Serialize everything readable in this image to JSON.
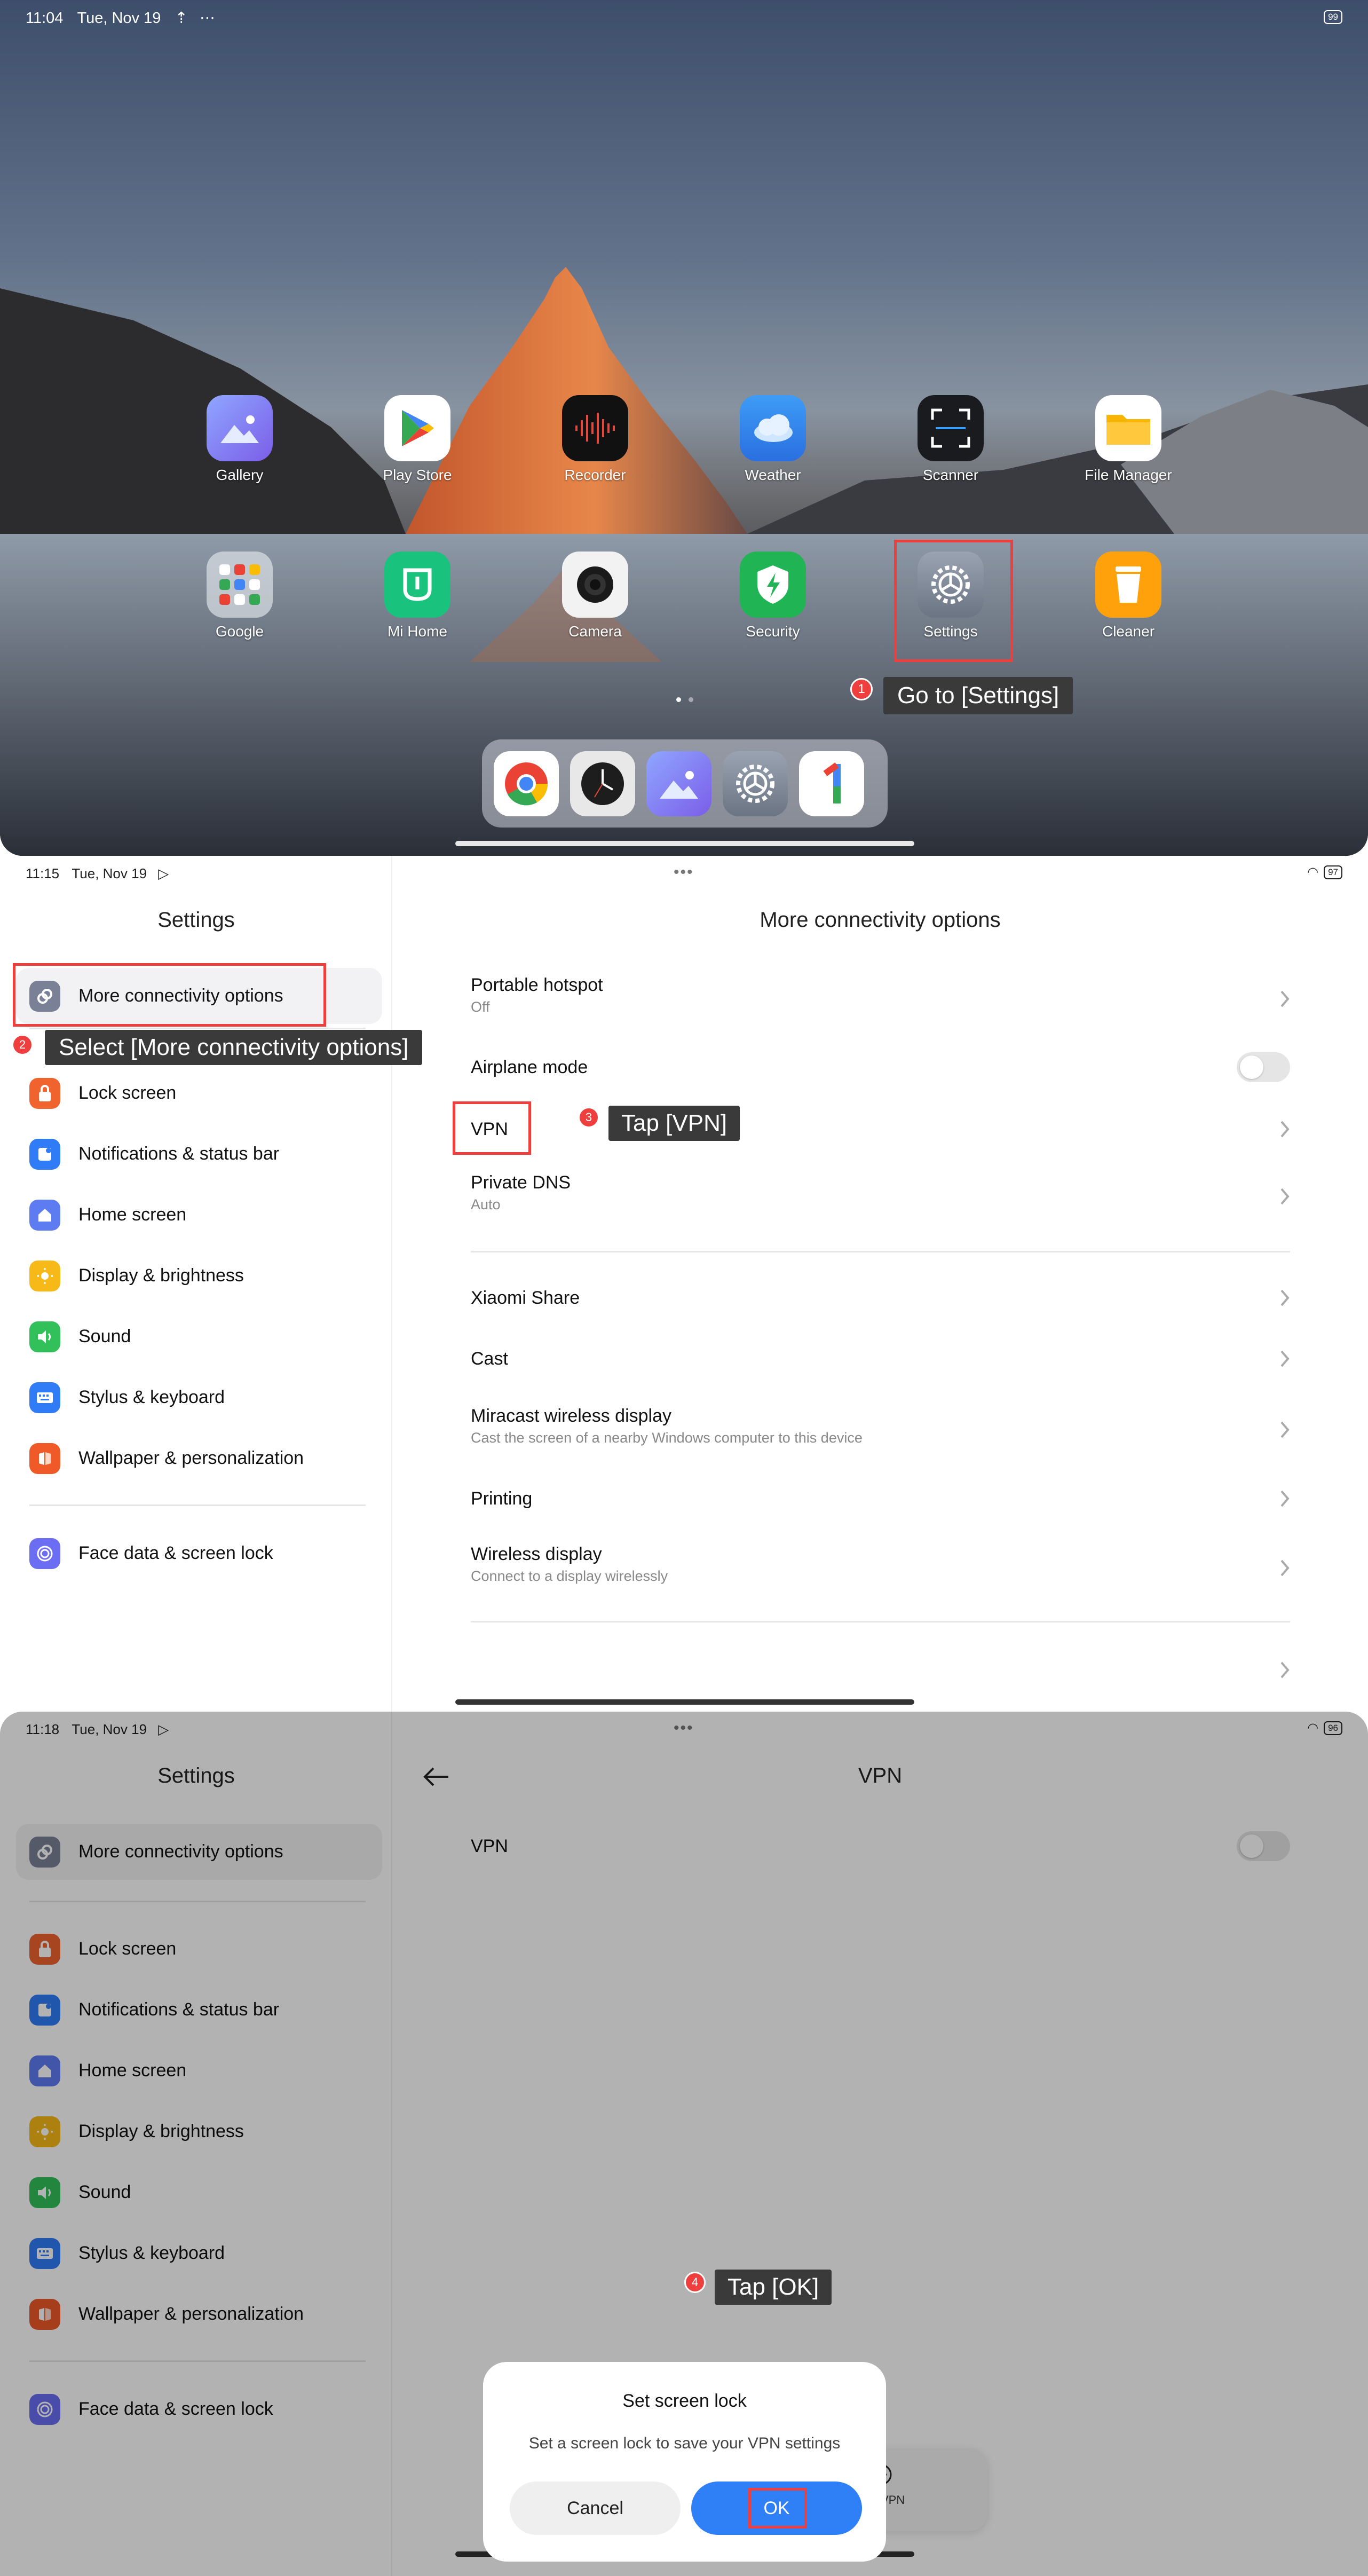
{
  "home": {
    "status": {
      "time": "11:04",
      "date": "Tue, Nov 19",
      "extra": "⋯",
      "battery": "99"
    },
    "apps_row1": [
      {
        "label": "Gallery",
        "icon": "gallery-icon"
      },
      {
        "label": "Play Store",
        "icon": "play-store-icon"
      },
      {
        "label": "Recorder",
        "icon": "recorder-icon"
      },
      {
        "label": "Weather",
        "icon": "weather-icon"
      },
      {
        "label": "Scanner",
        "icon": "scanner-icon"
      },
      {
        "label": "File Manager",
        "icon": "folder-icon"
      }
    ],
    "apps_row2": [
      {
        "label": "Google",
        "icon": "google-folder-icon"
      },
      {
        "label": "Mi Home",
        "icon": "mi-home-icon"
      },
      {
        "label": "Camera",
        "icon": "camera-icon"
      },
      {
        "label": "Security",
        "icon": "security-icon"
      },
      {
        "label": "Settings",
        "icon": "settings-gear-icon"
      },
      {
        "label": "Cleaner",
        "icon": "cleaner-icon"
      }
    ],
    "dock": [
      "chrome-icon",
      "clock-icon",
      "gallery-icon",
      "settings-gear-icon",
      "google-one-icon"
    ],
    "step": {
      "number": "1",
      "text": "Go to [Settings]"
    }
  },
  "settings_panel": {
    "status": {
      "time": "11:15",
      "date": "Tue, Nov 19",
      "battery": "97"
    },
    "title": "Settings",
    "menu": [
      {
        "label": "More connectivity options",
        "icon": "link-icon",
        "color": "#7a8197"
      },
      {
        "label": "Lock screen",
        "icon": "lock-icon",
        "color": "#f0632e"
      },
      {
        "label": "Notifications & status bar",
        "icon": "notification-icon",
        "color": "#2f7cf6"
      },
      {
        "label": "Home screen",
        "icon": "home-icon",
        "color": "#5e7cf2"
      },
      {
        "label": "Display & brightness",
        "icon": "sun-icon",
        "color": "#f6b917"
      },
      {
        "label": "Sound",
        "icon": "speaker-icon",
        "color": "#32c05a"
      },
      {
        "label": "Stylus & keyboard",
        "icon": "keyboard-icon",
        "color": "#2f7cf6"
      },
      {
        "label": "Wallpaper & personalization",
        "icon": "wallpaper-icon",
        "color": "#f05a28"
      },
      {
        "label": "Face data & screen lock",
        "icon": "face-icon",
        "color": "#6b6ef2"
      }
    ],
    "detail_title": "More connectivity options",
    "rows": [
      {
        "title": "Portable hotspot",
        "subtitle": "Off"
      },
      {
        "title": "Airplane mode",
        "subtitle": ""
      },
      {
        "title": "VPN",
        "subtitle": ""
      },
      {
        "title": "Private DNS",
        "subtitle": "Auto"
      },
      {
        "title": "Xiaomi Share",
        "subtitle": ""
      },
      {
        "title": "Cast",
        "subtitle": ""
      },
      {
        "title": "Miracast wireless display",
        "subtitle": "Cast the screen of a nearby Windows computer to this device"
      },
      {
        "title": "Printing",
        "subtitle": ""
      },
      {
        "title": "Wireless display",
        "subtitle": "Connect to a display wirelessly"
      }
    ],
    "step2": {
      "number": "2",
      "text": "Select [More connectivity options]"
    },
    "step3": {
      "number": "3",
      "text": "Tap [VPN]"
    }
  },
  "vpn_panel": {
    "status": {
      "time": "11:18",
      "date": "Tue, Nov 19",
      "battery": "96"
    },
    "title": "Settings",
    "detail_title": "VPN",
    "vpn_label": "VPN",
    "dialog": {
      "title": "Set screen lock",
      "message": "Set a screen lock to save your VPN settings",
      "cancel": "Cancel",
      "ok": "OK"
    },
    "add_vpn": "Add VPN",
    "step4": {
      "number": "4",
      "text": "Tap [OK]"
    }
  }
}
